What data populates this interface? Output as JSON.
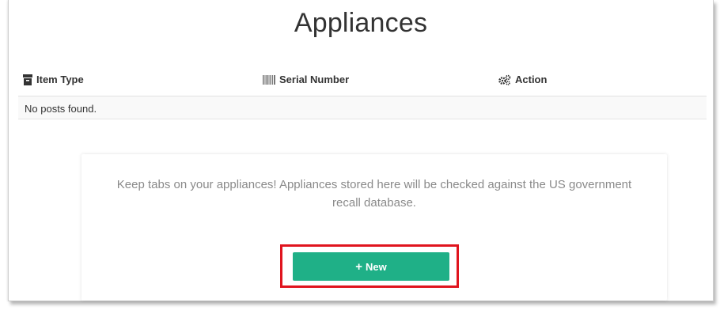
{
  "page": {
    "title": "Appliances"
  },
  "table": {
    "columns": [
      {
        "label": "Item Type",
        "icon": "archive-icon"
      },
      {
        "label": "Serial Number",
        "icon": "barcode-icon"
      },
      {
        "label": "Action",
        "icon": "cogs-icon"
      }
    ],
    "empty_message": "No posts found."
  },
  "info_panel": {
    "text": "Keep tabs on your appliances! Appliances stored here will be checked against the US government recall database.",
    "new_button": {
      "icon": "plus-icon",
      "label": "New"
    },
    "highlight_color": "#e0141e"
  },
  "colors": {
    "primary_button": "#1fb087",
    "text_dark": "#333333",
    "text_muted": "#8a8a8a"
  }
}
